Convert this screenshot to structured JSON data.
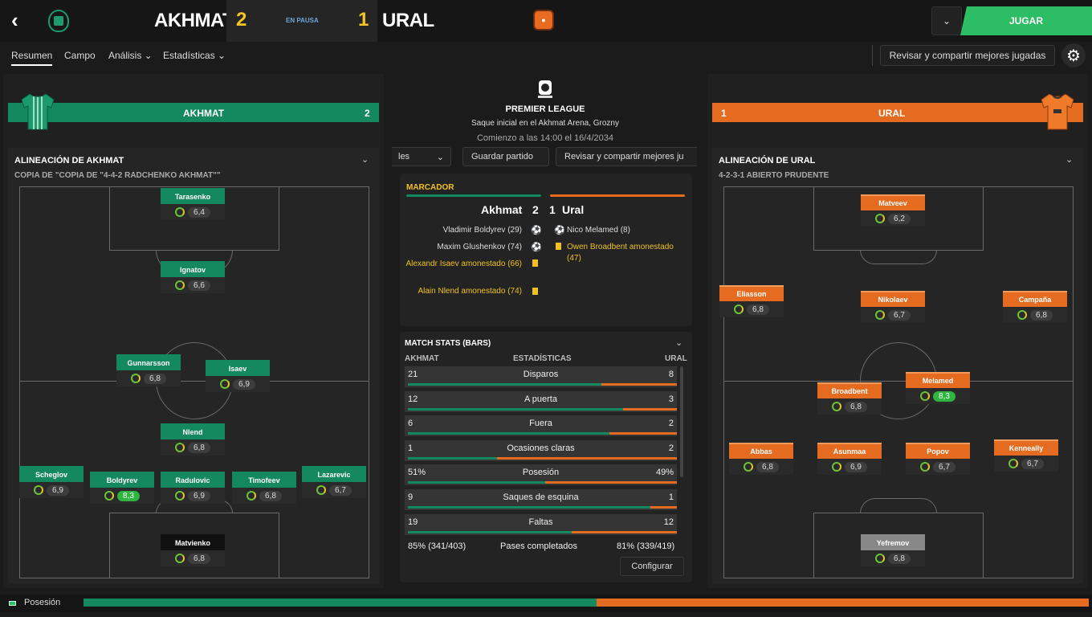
{
  "header": {
    "home_team": "AKHMAT",
    "home_score": "2",
    "status": "EN PAUSA",
    "away_score": "1",
    "away_team": "URAL",
    "play_label": "JUGAR"
  },
  "tabs": [
    {
      "label": "Resumen"
    },
    {
      "label": "Campo"
    },
    {
      "label": "Análisis ⌄"
    },
    {
      "label": "Estadísticas ⌄"
    }
  ],
  "toolbar": {
    "review_label": "Revisar y compartir mejores jugadas"
  },
  "home": {
    "banner_name": "AKHMAT",
    "banner_score": "2",
    "lineup_title": "ALINEACIÓN DE AKHMAT",
    "lineup_sub": "COPIA DE \"COPIA DE \"4-4-2 RADCHENKO AKHMAT\"\"",
    "players": [
      {
        "name": "Tarasenko",
        "rating": "6,4"
      },
      {
        "name": "Ignatov",
        "rating": "6,6"
      },
      {
        "name": "Gunnarsson",
        "rating": "6,8"
      },
      {
        "name": "Isaev",
        "rating": "6,9"
      },
      {
        "name": "Nlend",
        "rating": "6,8"
      },
      {
        "name": "Scheglov",
        "rating": "6,9"
      },
      {
        "name": "Boldyrev",
        "rating": "8,3"
      },
      {
        "name": "Radulovic",
        "rating": "6,9"
      },
      {
        "name": "Timofeev",
        "rating": "6,8"
      },
      {
        "name": "Lazarevic",
        "rating": "6,7"
      },
      {
        "name": "Matvienko",
        "rating": "6,8"
      }
    ]
  },
  "away": {
    "banner_name": "URAL",
    "banner_score": "1",
    "lineup_title": "ALINEACIÓN DE URAL",
    "lineup_sub": "4-2-3-1 ABIERTO PRUDENTE",
    "players": [
      {
        "name": "Matveev",
        "rating": "6,2"
      },
      {
        "name": "Eliasson",
        "rating": "6,8"
      },
      {
        "name": "Nikolaev",
        "rating": "6,7"
      },
      {
        "name": "Campaña",
        "rating": "6,8"
      },
      {
        "name": "Broadbent",
        "rating": "6,8"
      },
      {
        "name": "Melamed",
        "rating": "8,3"
      },
      {
        "name": "Abbas",
        "rating": "6,8"
      },
      {
        "name": "Asunmaa",
        "rating": "6,9"
      },
      {
        "name": "Popov",
        "rating": "6,7"
      },
      {
        "name": "Kenneally",
        "rating": "6,7"
      },
      {
        "name": "Yefremov",
        "rating": "6,8"
      }
    ]
  },
  "match": {
    "competition": "PREMIER LEAGUE",
    "venue": "Saque inicial en el Akhmat Arena, Grozny",
    "kickoff": "Comienzo a las 14:00 el 16/4/2034",
    "btn_left": "les",
    "btn_save": "Guardar partido",
    "btn_review": "Revisar y compartir mejores ju"
  },
  "scoreboard": {
    "title": "MARCADOR",
    "home": "Akhmat",
    "home_goals": "2",
    "away_goals": "1",
    "away": "Ural",
    "home_events": [
      {
        "text": "Vladimir Boldyrev (29)",
        "icon": "ball-icon"
      },
      {
        "text": "Maxim Glushenkov (74)",
        "icon": "ball-icon"
      },
      {
        "text": "Alexandr Isaev amonestado (66)",
        "icon": "yellow-card-icon"
      },
      {
        "text": "Alain Nlend amonestado (74)",
        "icon": "yellow-card-icon"
      }
    ],
    "away_events": [
      {
        "text": "Nico Melamed (8)",
        "icon": "ball-icon"
      },
      {
        "text": "Owen Broadbent amonestado (47)",
        "icon": "yellow-card-icon"
      }
    ]
  },
  "stats": {
    "title": "MATCH STATS (BARS)",
    "head_home": "AKHMAT",
    "head_mid": "ESTADÍSTICAS",
    "head_away": "URAL",
    "rows": [
      {
        "label": "Disparos",
        "home": "21",
        "away": "8",
        "home_frac": 0.72
      },
      {
        "label": "A puerta",
        "home": "12",
        "away": "3",
        "home_frac": 0.8
      },
      {
        "label": "Fuera",
        "home": "6",
        "away": "2",
        "home_frac": 0.75
      },
      {
        "label": "Ocasiones claras",
        "home": "1",
        "away": "2",
        "home_frac": 0.33
      },
      {
        "label": "Posesión",
        "home": "51%",
        "away": "49%",
        "home_frac": 0.51
      },
      {
        "label": "Saques de esquina",
        "home": "9",
        "away": "1",
        "home_frac": 0.9
      },
      {
        "label": "Faltas",
        "home": "19",
        "away": "12",
        "home_frac": 0.61
      }
    ],
    "passes": {
      "home": "85% (341/403)",
      "label": "Pases completados",
      "away": "81% (339/419)"
    },
    "configure": "Configurar"
  },
  "footer": {
    "label": "Posesión",
    "home_frac": 0.51
  },
  "colors": {
    "home": "#14885f",
    "away": "#e46b20",
    "play": "#2dbd64",
    "score": "#f5c623"
  }
}
